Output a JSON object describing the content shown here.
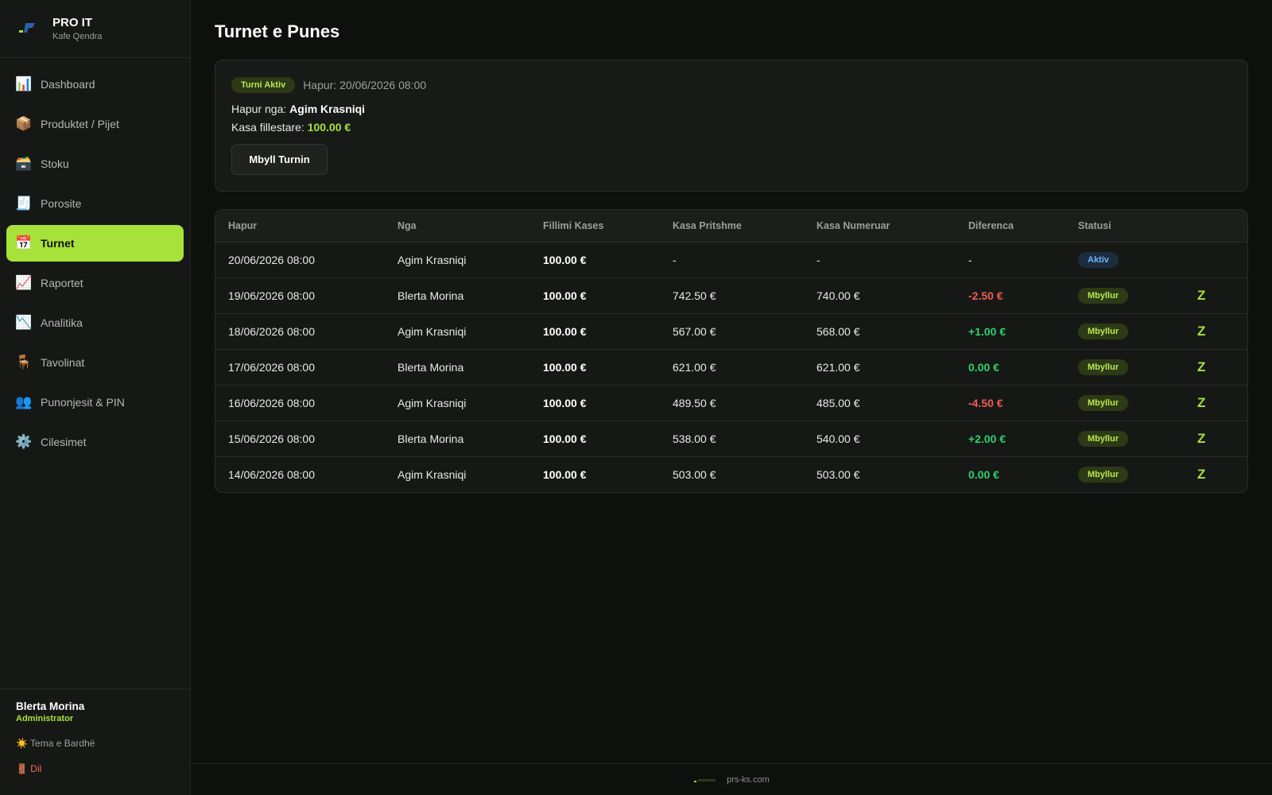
{
  "brand": {
    "title": "PRO IT",
    "subtitle": "Kafe Qendra"
  },
  "nav": [
    {
      "label": "Dashboard",
      "icon": "📊",
      "icon_name": "bar-chart-icon"
    },
    {
      "label": "Produktet / Pijet",
      "icon": "📦",
      "icon_name": "package-icon"
    },
    {
      "label": "Stoku",
      "icon": "🗃️",
      "icon_name": "card-box-icon"
    },
    {
      "label": "Porosite",
      "icon": "🧾",
      "icon_name": "receipt-icon"
    },
    {
      "label": "Turnet",
      "icon": "📅",
      "icon_name": "calendar-icon",
      "active": true
    },
    {
      "label": "Raportet",
      "icon": "📈",
      "icon_name": "chart-up-icon"
    },
    {
      "label": "Analitika",
      "icon": "📉",
      "icon_name": "chart-down-icon"
    },
    {
      "label": "Tavolinat",
      "icon": "🪑",
      "icon_name": "chair-icon"
    },
    {
      "label": "Punonjesit & PIN",
      "icon": "👥",
      "icon_name": "users-icon"
    },
    {
      "label": "Cilesimet",
      "icon": "⚙️",
      "icon_name": "gear-icon"
    }
  ],
  "user": {
    "name": "Blerta Morina",
    "role": "Administrator",
    "theme_label": "☀️ Tema e Bardhë",
    "logout_label": "🚪 Dil"
  },
  "page": {
    "title": "Turnet e Punes"
  },
  "active_shift": {
    "badge": "Turni Aktiv",
    "opened_at": "Hapur: 20/06/2026 08:00",
    "opened_by_label": "Hapur nga:",
    "opened_by": "Agim Krasniqi",
    "start_cash_label": "Kasa fillestare:",
    "start_cash": "100.00 €",
    "close_button": "Mbyll Turnin"
  },
  "table": {
    "headers": [
      "Hapur",
      "Nga",
      "Fillimi Kases",
      "Kasa Pritshme",
      "Kasa Numeruar",
      "Diferenca",
      "Statusi",
      ""
    ],
    "rows": [
      {
        "opened": "20/06/2026 08:00",
        "by": "Agim Krasniqi",
        "start": "100.00 €",
        "expected": "-",
        "counted": "-",
        "diff": "-",
        "diff_type": "none",
        "status": "Aktiv",
        "status_type": "active",
        "action": ""
      },
      {
        "opened": "19/06/2026 08:00",
        "by": "Blerta Morina",
        "start": "100.00 €",
        "expected": "742.50 €",
        "counted": "740.00 €",
        "diff": "-2.50 €",
        "diff_type": "neg",
        "status": "Mbyllur",
        "status_type": "closed",
        "action": "Z"
      },
      {
        "opened": "18/06/2026 08:00",
        "by": "Agim Krasniqi",
        "start": "100.00 €",
        "expected": "567.00 €",
        "counted": "568.00 €",
        "diff": "+1.00 €",
        "diff_type": "pos",
        "status": "Mbyllur",
        "status_type": "closed",
        "action": "Z"
      },
      {
        "opened": "17/06/2026 08:00",
        "by": "Blerta Morina",
        "start": "100.00 €",
        "expected": "621.00 €",
        "counted": "621.00 €",
        "diff": "0.00 €",
        "diff_type": "pos",
        "status": "Mbyllur",
        "status_type": "closed",
        "action": "Z"
      },
      {
        "opened": "16/06/2026 08:00",
        "by": "Agim Krasniqi",
        "start": "100.00 €",
        "expected": "489.50 €",
        "counted": "485.00 €",
        "diff": "-4.50 €",
        "diff_type": "neg",
        "status": "Mbyllur",
        "status_type": "closed",
        "action": "Z"
      },
      {
        "opened": "15/06/2026 08:00",
        "by": "Blerta Morina",
        "start": "100.00 €",
        "expected": "538.00 €",
        "counted": "540.00 €",
        "diff": "+2.00 €",
        "diff_type": "pos",
        "status": "Mbyllur",
        "status_type": "closed",
        "action": "Z"
      },
      {
        "opened": "14/06/2026 08:00",
        "by": "Agim Krasniqi",
        "start": "100.00 €",
        "expected": "503.00 €",
        "counted": "503.00 €",
        "diff": "0.00 €",
        "diff_type": "pos",
        "status": "Mbyllur",
        "status_type": "closed",
        "action": "Z"
      }
    ]
  },
  "footer": {
    "text": "prs-ks.com"
  },
  "colors": {
    "accent": "#a6e23a",
    "negative": "#ef5b52",
    "positive": "#2fd06b",
    "active_badge": "#6ab6ff"
  }
}
